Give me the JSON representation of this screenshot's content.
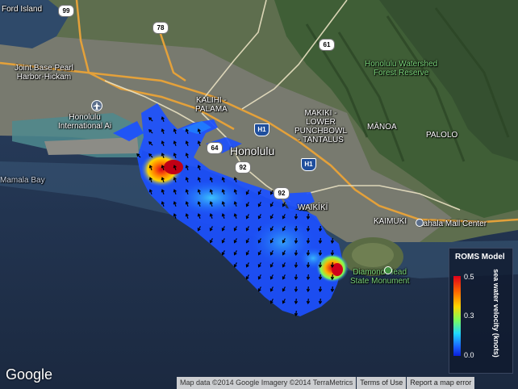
{
  "map": {
    "places": {
      "ford_island": "Ford Island",
      "joint_base": "Joint Base Pearl\nHarbor-Hickam",
      "honolulu_airport": "Honolulu\nInternational Ai",
      "kalihi_palama": "KALIHI -\nPALAMA",
      "makiki": "MAKIKI -\nLOWER\nPUNCHBOWL\n- TANTALUS",
      "manoa": "MĀNOA",
      "palolo": "PALOLO",
      "honolulu": "Honolulu",
      "watershed": "Honolulu Watershed\nForest Reserve",
      "waikiki": "WAIKĪKĪ",
      "kaimuki": "KAIMUKI",
      "kahala": "Kahala Mall Center",
      "diamond_head": "Diamond Head\nState Monument",
      "mamala_bay": "Mamala Bay"
    },
    "routes": {
      "r99": "99",
      "r78": "78",
      "r61": "61",
      "r64": "64",
      "r92a": "92",
      "r92b": "92",
      "h1a": "H1",
      "h1b": "H1"
    }
  },
  "legend": {
    "title": "ROMS Model",
    "axis_label": "sea water velocity (knots)",
    "ticks": [
      "0.5",
      "0.3",
      "0.0"
    ],
    "colors": [
      "#e0001a",
      "#ff6a00",
      "#ffd500",
      "#7dff5a",
      "#1fd9ff",
      "#1a66ff",
      "#0b1fd9"
    ]
  },
  "footer": {
    "logo": "Google",
    "map_data": "Map data ©2014 Google Imagery ©2014 TerraMetrics",
    "terms": "Terms of Use",
    "report": "Report a map error"
  }
}
